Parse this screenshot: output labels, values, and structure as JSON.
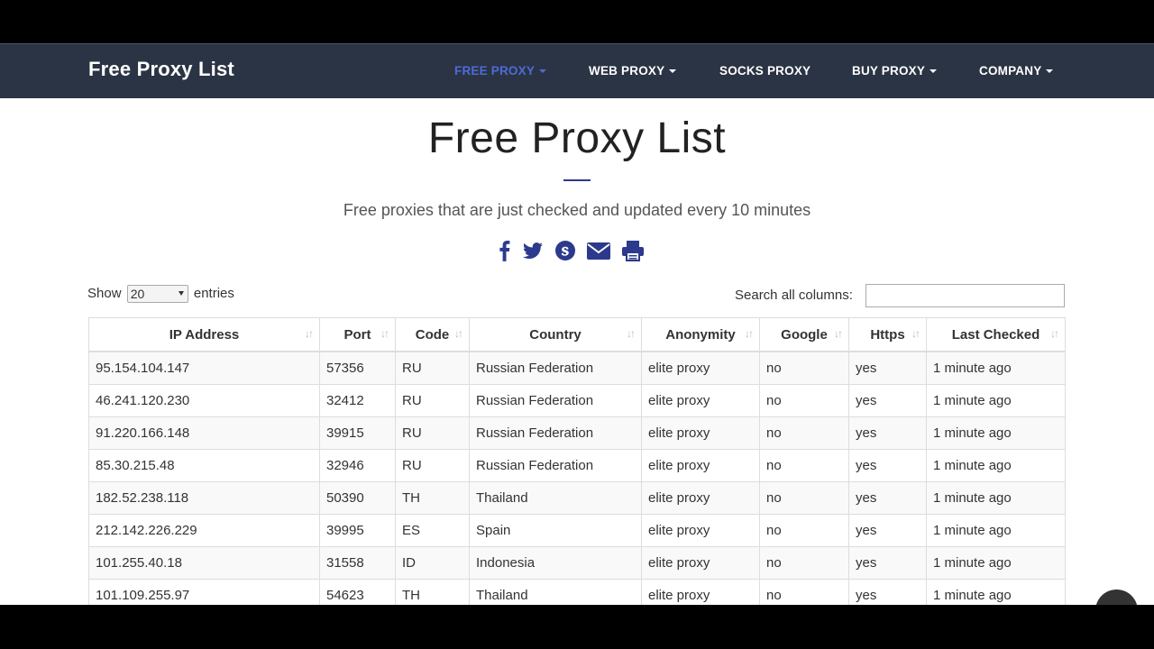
{
  "navbar": {
    "brand": "Free Proxy List",
    "items": [
      {
        "label": "FREE PROXY",
        "dropdown": true,
        "active": true
      },
      {
        "label": "WEB PROXY",
        "dropdown": true
      },
      {
        "label": "SOCKS PROXY",
        "dropdown": false
      },
      {
        "label": "BUY PROXY",
        "dropdown": true
      },
      {
        "label": "COMPANY",
        "dropdown": true
      }
    ]
  },
  "hero": {
    "title": "Free Proxy List",
    "subtitle": "Free proxies that are just checked and updated every 10 minutes"
  },
  "share": {
    "icons": [
      "facebook-icon",
      "twitter-icon",
      "skype-icon",
      "email-icon",
      "print-icon"
    ],
    "color": "#2b3a8c"
  },
  "controls": {
    "show_label": "Show",
    "entries_value": "20",
    "entries_label": "entries",
    "search_label": "Search all columns:",
    "search_value": ""
  },
  "table": {
    "columns": [
      "IP Address",
      "Port",
      "Code",
      "Country",
      "Anonymity",
      "Google",
      "Https",
      "Last Checked"
    ],
    "rows": [
      [
        "95.154.104.147",
        "57356",
        "RU",
        "Russian Federation",
        "elite proxy",
        "no",
        "yes",
        "1 minute ago"
      ],
      [
        "46.241.120.230",
        "32412",
        "RU",
        "Russian Federation",
        "elite proxy",
        "no",
        "yes",
        "1 minute ago"
      ],
      [
        "91.220.166.148",
        "39915",
        "RU",
        "Russian Federation",
        "elite proxy",
        "no",
        "yes",
        "1 minute ago"
      ],
      [
        "85.30.215.48",
        "32946",
        "RU",
        "Russian Federation",
        "elite proxy",
        "no",
        "yes",
        "1 minute ago"
      ],
      [
        "182.52.238.118",
        "50390",
        "TH",
        "Thailand",
        "elite proxy",
        "no",
        "yes",
        "1 minute ago"
      ],
      [
        "212.142.226.229",
        "39995",
        "ES",
        "Spain",
        "elite proxy",
        "no",
        "yes",
        "1 minute ago"
      ],
      [
        "101.255.40.18",
        "31558",
        "ID",
        "Indonesia",
        "elite proxy",
        "no",
        "yes",
        "1 minute ago"
      ],
      [
        "101.109.255.97",
        "54623",
        "TH",
        "Thailand",
        "elite proxy",
        "no",
        "yes",
        "1 minute ago"
      ]
    ]
  },
  "colors": {
    "navbar_bg": "#2b3444",
    "nav_active": "#4d6bd8",
    "accent": "#2b3a8c"
  }
}
